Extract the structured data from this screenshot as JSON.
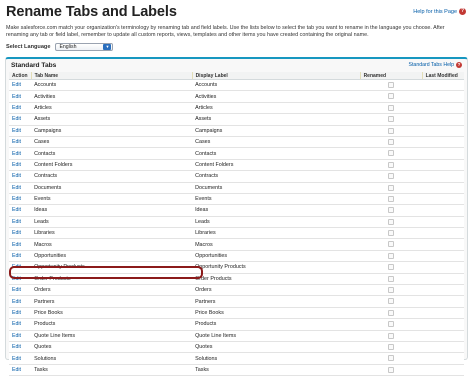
{
  "page": {
    "title": "Rename Tabs and Labels",
    "help_link": "Help for this Page",
    "intro": "Make salesforce.com match your organization's terminology by renaming tab and field labels. Use the lists below to select the tab you want to rename in the language you choose. After renaming any tab or field label, remember to update all custom reports, views, templates and other items you have created containing the original name."
  },
  "language": {
    "label": "Select Language",
    "selected": "English"
  },
  "panel": {
    "title": "Standard Tabs",
    "help_link": "Standard Tabs Help"
  },
  "table": {
    "headers": {
      "action": "Action",
      "tab_name": "Tab Name",
      "display_label": "Display Label",
      "renamed": "Renamed",
      "last_modified": "Last Modified"
    },
    "rows": [
      {
        "action": "Edit",
        "tab": "Accounts",
        "label": "Accounts"
      },
      {
        "action": "Edit",
        "tab": "Activities",
        "label": "Activities"
      },
      {
        "action": "Edit",
        "tab": "Articles",
        "label": "Articles"
      },
      {
        "action": "Edit",
        "tab": "Assets",
        "label": "Assets"
      },
      {
        "action": "Edit",
        "tab": "Campaigns",
        "label": "Campaigns"
      },
      {
        "action": "Edit",
        "tab": "Cases",
        "label": "Cases"
      },
      {
        "action": "Edit",
        "tab": "Contacts",
        "label": "Contacts"
      },
      {
        "action": "Edit",
        "tab": "Content Folders",
        "label": "Content Folders"
      },
      {
        "action": "Edit",
        "tab": "Contracts",
        "label": "Contracts"
      },
      {
        "action": "Edit",
        "tab": "Documents",
        "label": "Documents"
      },
      {
        "action": "Edit",
        "tab": "Events",
        "label": "Events"
      },
      {
        "action": "Edit",
        "tab": "Ideas",
        "label": "Ideas"
      },
      {
        "action": "Edit",
        "tab": "Leads",
        "label": "Leads"
      },
      {
        "action": "Edit",
        "tab": "Libraries",
        "label": "Libraries"
      },
      {
        "action": "Edit",
        "tab": "Macros",
        "label": "Macros"
      },
      {
        "action": "Edit",
        "tab": "Opportunities",
        "label": "Opportunities"
      },
      {
        "action": "Edit",
        "tab": "Opportunity Products",
        "label": "Opportunity Products"
      },
      {
        "action": "Edit",
        "tab": "Order Products",
        "label": "Order Products"
      },
      {
        "action": "Edit",
        "tab": "Orders",
        "label": "Orders"
      },
      {
        "action": "Edit",
        "tab": "Partners",
        "label": "Partners"
      },
      {
        "action": "Edit",
        "tab": "Price Books",
        "label": "Price Books"
      },
      {
        "action": "Edit",
        "tab": "Products",
        "label": "Products"
      },
      {
        "action": "Edit",
        "tab": "Quote Line Items",
        "label": "Quote Line Items"
      },
      {
        "action": "Edit",
        "tab": "Quotes",
        "label": "Quotes"
      },
      {
        "action": "Edit",
        "tab": "Solutions",
        "label": "Solutions"
      },
      {
        "action": "Edit",
        "tab": "Tasks",
        "label": "Tasks"
      }
    ]
  },
  "colors": {
    "link": "#015ba7",
    "panel_accent": "#1797c0",
    "highlight": "#8b1a1a"
  }
}
